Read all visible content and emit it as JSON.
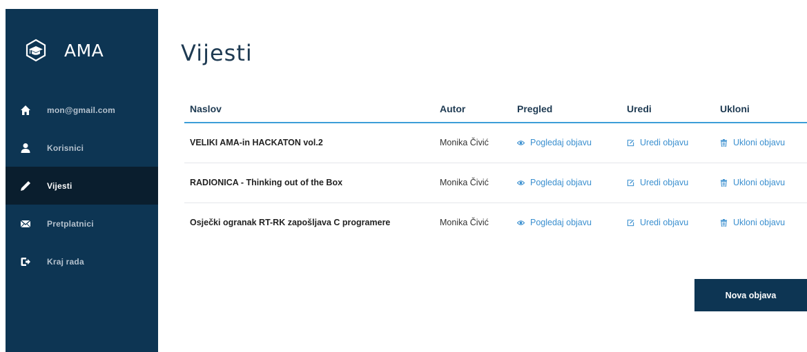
{
  "brand": {
    "name": "AMA",
    "icon": "graduation-cap-icon"
  },
  "sidebar": {
    "items": [
      {
        "label": "mon@gmail.com",
        "icon": "home-icon",
        "active": false
      },
      {
        "label": "Korisnici",
        "icon": "user-icon",
        "active": false
      },
      {
        "label": "Vijesti",
        "icon": "pencil-icon",
        "active": true
      },
      {
        "label": "Pretplatnici",
        "icon": "envelope-icon",
        "active": false
      },
      {
        "label": "Kraj rada",
        "icon": "logout-icon",
        "active": false
      }
    ]
  },
  "page": {
    "title": "Vijesti"
  },
  "table": {
    "headers": {
      "title": "Naslov",
      "author": "Autor",
      "view": "Pregled",
      "edit": "Uredi",
      "remove": "Ukloni"
    },
    "rows": [
      {
        "title": "VELIKI AMA-in HACKATON vol.2",
        "author": "Monika Čivić",
        "view": "Pogledaj objavu",
        "edit": "Uredi objavu",
        "remove": "Ukloni objavu"
      },
      {
        "title": "RADIONICA - Thinking out of the Box",
        "author": "Monika Čivić",
        "view": "Pogledaj objavu",
        "edit": "Uredi objavu",
        "remove": "Ukloni objavu"
      },
      {
        "title": "Osječki ogranak RT-RK zapošljava C programere",
        "author": "Monika Čivić",
        "view": "Pogledaj objavu",
        "edit": "Uredi objavu",
        "remove": "Ukloni objavu"
      }
    ]
  },
  "actions": {
    "new_post": "Nova objava"
  },
  "colors": {
    "sidebar_bg": "#0d3553",
    "active_bg": "#0a1e2e",
    "accent": "#3b9dd8",
    "link": "#3a8fcf"
  }
}
